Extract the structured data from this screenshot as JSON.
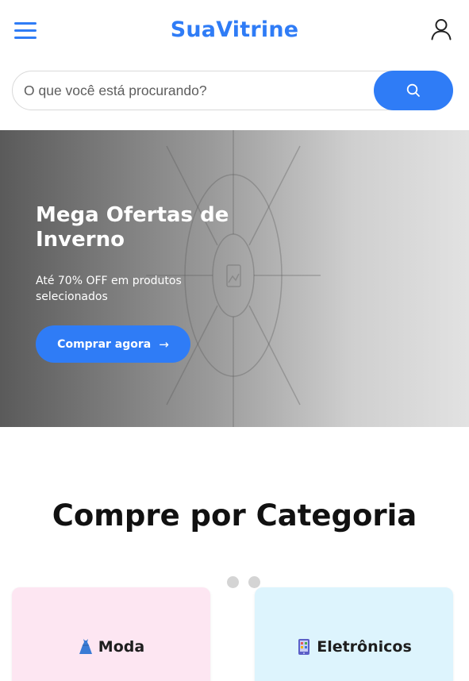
{
  "header": {
    "logo": "SuaVitrine",
    "menu_icon": "hamburger-menu-icon",
    "user_icon": "user-icon"
  },
  "search": {
    "placeholder": "O que você está procurando?",
    "icon": "search-icon"
  },
  "hero": {
    "title": "Mega Ofertas de Inverno",
    "subtitle": "Até 70% OFF em produtos selecionados",
    "cta_label": "Comprar agora",
    "cta_icon": "→",
    "image_icon": "image-placeholder-icon"
  },
  "categories": {
    "title": "Compre por Categoria",
    "carousel_pages": 2,
    "items": [
      {
        "label": "Moda",
        "icon": "dress-icon",
        "color": "#fde6f2"
      },
      {
        "label": "Eletrônicos",
        "icon": "tablet-icon",
        "color": "#ddf4fd"
      }
    ]
  },
  "colors": {
    "accent": "#2f7cf6"
  }
}
